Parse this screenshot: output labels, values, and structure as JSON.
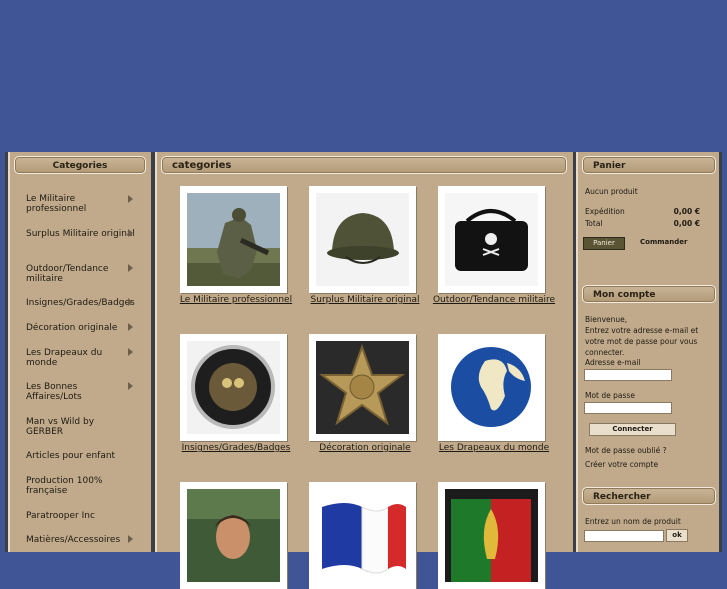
{
  "left": {
    "title": "Categories",
    "items": [
      {
        "label": "Le Militaire professionnel",
        "arrow": true
      },
      {
        "label": "Surplus Militaire original",
        "arrow": true
      },
      {
        "label": "Outdoor/Tendance militaire",
        "arrow": true
      },
      {
        "label": "Insignes/Grades/Badges",
        "arrow": true
      },
      {
        "label": "Décoration originale",
        "arrow": true
      },
      {
        "label": "Les Drapeaux du monde",
        "arrow": true
      },
      {
        "label": "Les Bonnes Affaires/Lots",
        "arrow": true
      },
      {
        "label": "Man vs Wild by GERBER",
        "arrow": false
      },
      {
        "label": "Articles pour enfant",
        "arrow": false
      },
      {
        "label": "Production 100% française",
        "arrow": false
      },
      {
        "label": "Paratrooper Inc",
        "arrow": false
      },
      {
        "label": "Matières/Accessoires",
        "arrow": true
      }
    ]
  },
  "main": {
    "title": "categories",
    "products": [
      {
        "caption": "Le Militaire professionnel",
        "image": "soldier"
      },
      {
        "caption": "Surplus Militaire original",
        "image": "helmet"
      },
      {
        "caption": "Outdoor/Tendance militaire",
        "image": "bag"
      },
      {
        "caption": "Insignes/Grades/Badges",
        "image": "coin"
      },
      {
        "caption": "Décoration originale",
        "image": "star-badge"
      },
      {
        "caption": "Les Drapeaux du monde",
        "image": "globe"
      },
      {
        "caption": "",
        "image": "man-portrait"
      },
      {
        "caption": "",
        "image": "french-flag"
      },
      {
        "caption": "",
        "image": "legion-badge"
      }
    ]
  },
  "cart": {
    "title": "Panier",
    "empty_text": "Aucun produit",
    "shipping_label": "Expédition",
    "shipping_value": "0,00 €",
    "total_label": "Total",
    "total_value": "0,00 €",
    "cart_button": "Panier",
    "order_button": "Commander"
  },
  "account": {
    "title": "Mon compte",
    "welcome": "Bienvenue,",
    "instructions": "Entrez votre adresse e-mail et votre mot de passe pour vous connecter.",
    "email_label": "Adresse e-mail",
    "email_value": "",
    "password_label": "Mot de passe",
    "password_value": "",
    "login_button": "Connecter",
    "forgot_link": "Mot de passe oublié ?",
    "create_link": "Créer votre compte"
  },
  "search": {
    "title": "Rechercher",
    "label": "Entrez un nom de produit",
    "value": "",
    "button": "ok"
  },
  "colors": {
    "header_bg": "#3f5595",
    "panel_bg": "#c0aa8b",
    "frame": "#3b4046"
  }
}
